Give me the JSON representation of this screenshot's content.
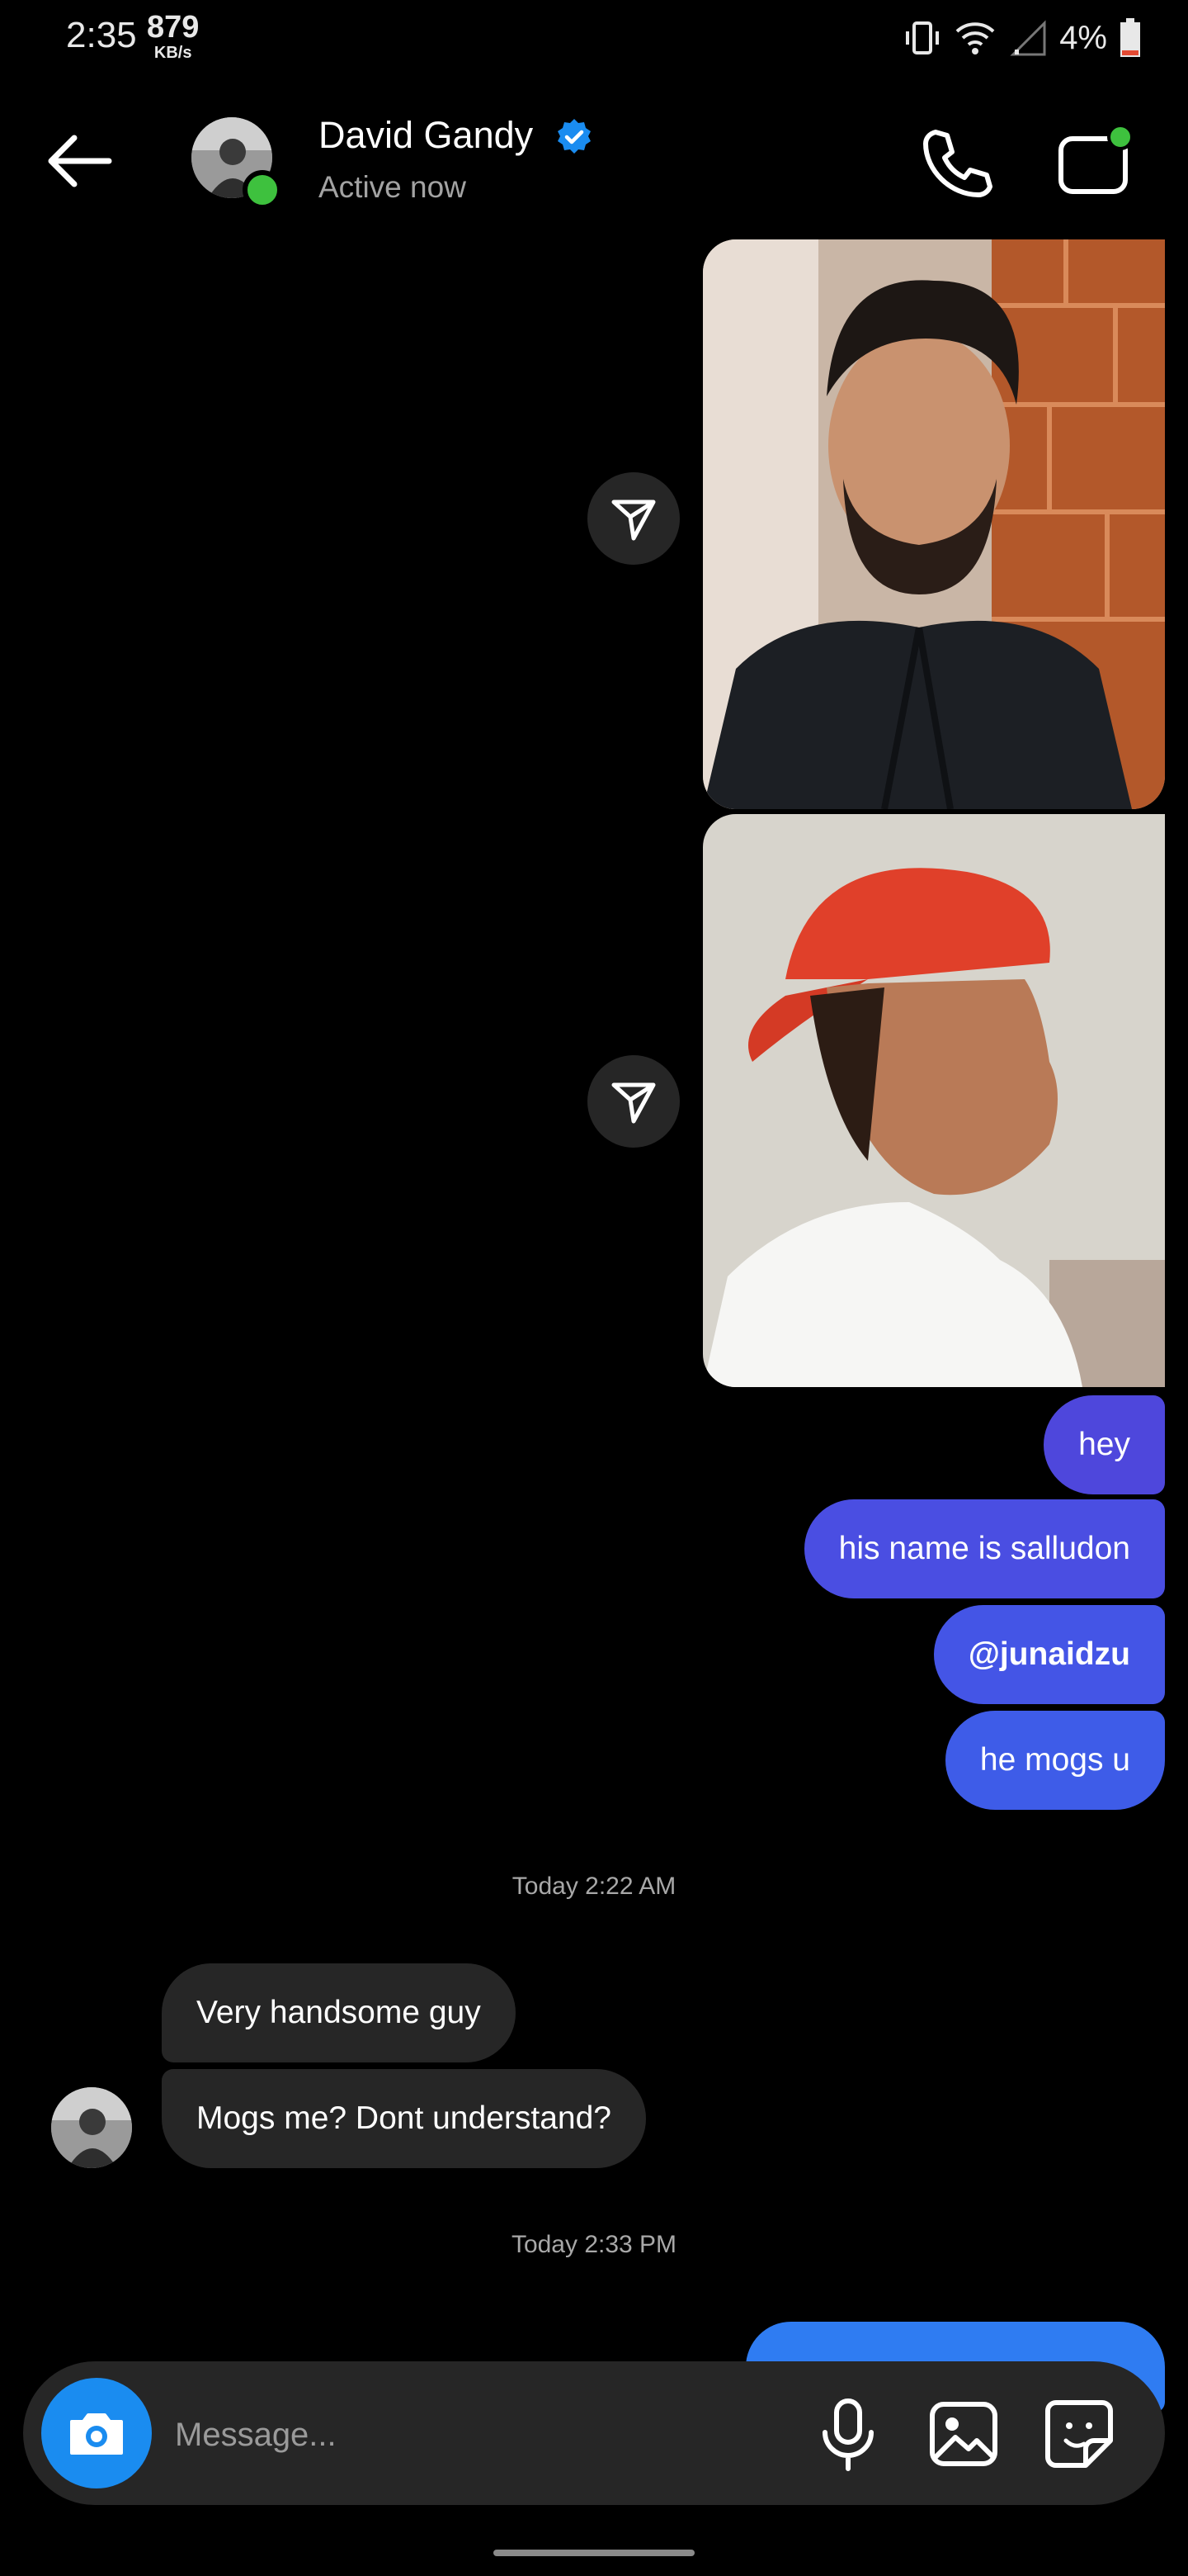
{
  "status_bar": {
    "time": "2:35",
    "net_speed": "879",
    "net_unit": "KB/s",
    "battery": "4%"
  },
  "header": {
    "name": "David Gandy",
    "status": "Active now"
  },
  "messages": {
    "out": [
      "hey",
      "his name is salludon",
      "@junaidzu",
      "he mogs u"
    ],
    "timestamp1": "Today 2:22 AM",
    "in": [
      "Very handsome guy",
      "Mogs me? Dont understand?"
    ],
    "timestamp2": "Today 2:33 PM"
  },
  "composer": {
    "placeholder": "Message..."
  },
  "colors": {
    "accent_blue": "#1a8cf0",
    "bubble_purple": "#4f4ee0",
    "incoming_bubble": "#262626",
    "online": "#3ec13e"
  }
}
